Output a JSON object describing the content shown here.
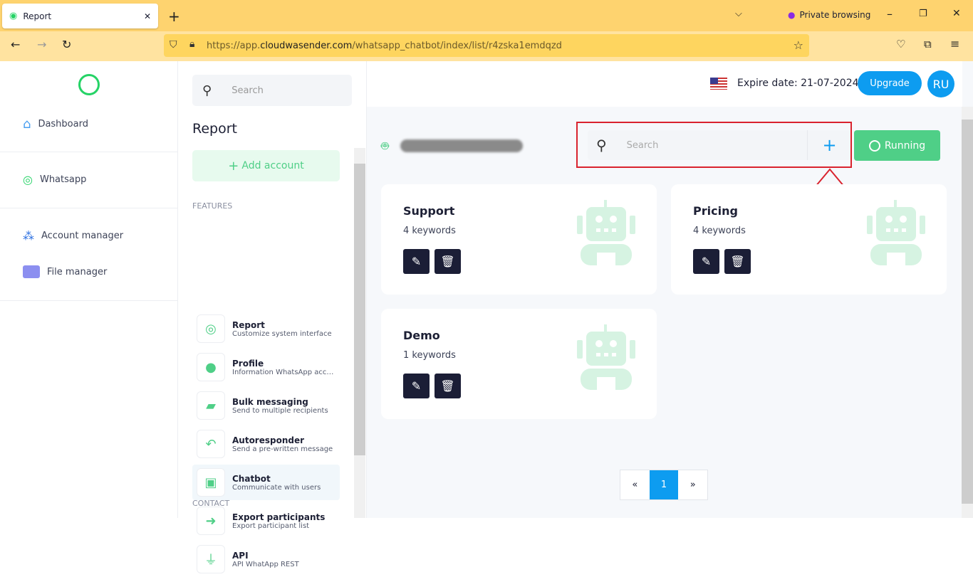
{
  "browser": {
    "tab_title": "Report",
    "private_label": "Private browsing",
    "url_prefix": "https://app.",
    "url_domain": "cloudwasender.com",
    "url_path": "/whatsapp_chatbot/index/list/r4zska1emdqzd"
  },
  "sidebar": {
    "items": [
      {
        "label": "Dashboard",
        "icon": "home-icon"
      },
      {
        "label": "Whatsapp",
        "icon": "whatsapp-icon"
      },
      {
        "label": "Account manager",
        "icon": "share-icon"
      },
      {
        "label": "File manager",
        "icon": "folder-icon"
      }
    ]
  },
  "features_panel": {
    "search_placeholder": "Search",
    "title": "Report",
    "add_account": "Add account",
    "section_features": "FEATURES",
    "section_contact": "CONTACT",
    "items": [
      {
        "title": "Report",
        "desc": "Customize system interface"
      },
      {
        "title": "Profile",
        "desc": "Information WhatsApp account"
      },
      {
        "title": "Bulk messaging",
        "desc": "Send to multiple recipients"
      },
      {
        "title": "Autoresponder",
        "desc": "Send a pre-written message"
      },
      {
        "title": "Chatbot",
        "desc": "Communicate with users",
        "active": true
      },
      {
        "title": "Export participants",
        "desc": "Export participant list"
      },
      {
        "title": "API",
        "desc": "API WhatApp REST"
      }
    ]
  },
  "header": {
    "expire": "Expire date: 21-07-2024",
    "upgrade": "Upgrade",
    "avatar": "RU"
  },
  "toolbar": {
    "search_placeholder": "Search",
    "add": "+",
    "status": "Running"
  },
  "cards": [
    {
      "title": "Support",
      "keywords": "4 keywords"
    },
    {
      "title": "Pricing",
      "keywords": "4 keywords"
    },
    {
      "title": "Demo",
      "keywords": "1 keywords"
    }
  ],
  "pagination": {
    "prev": "«",
    "current": "1",
    "next": "»"
  },
  "colors": {
    "accent": "#0d9cf0",
    "green": "#4fcf87",
    "dark": "#1b1e36",
    "annotation": "#d9232e"
  }
}
